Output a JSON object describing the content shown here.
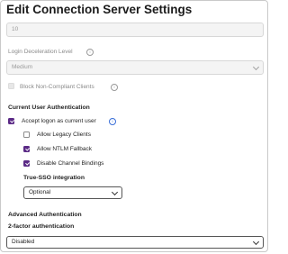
{
  "page": {
    "title": "Edit Connection Server Settings"
  },
  "connection_field": {
    "value": "10"
  },
  "login_deceleration": {
    "label": "Login Deceleration Level",
    "value": "Medium"
  },
  "block_non_compliant": {
    "label": "Block Non-Compliant Clients",
    "checked": false,
    "disabled": true
  },
  "current_user_auth": {
    "heading": "Current User Authentication",
    "accept_logon": {
      "label": "Accept logon as current user",
      "checked": true
    },
    "allow_legacy": {
      "label": "Allow Legacy Clients",
      "checked": false
    },
    "allow_ntlm": {
      "label": "Allow NTLM Fallback",
      "checked": true
    },
    "disable_channel": {
      "label": "Disable Channel Bindings",
      "checked": true
    }
  },
  "true_sso": {
    "label": "True-SSO integration",
    "value": "Optional"
  },
  "advanced_auth": {
    "heading": "Advanced Authentication",
    "two_factor": {
      "label": "2-factor authentication",
      "value": "Disabled"
    }
  },
  "colors": {
    "accent": "#5b2a86",
    "info": "#3a6fd8",
    "disabled_bg": "#f4f4f4"
  }
}
